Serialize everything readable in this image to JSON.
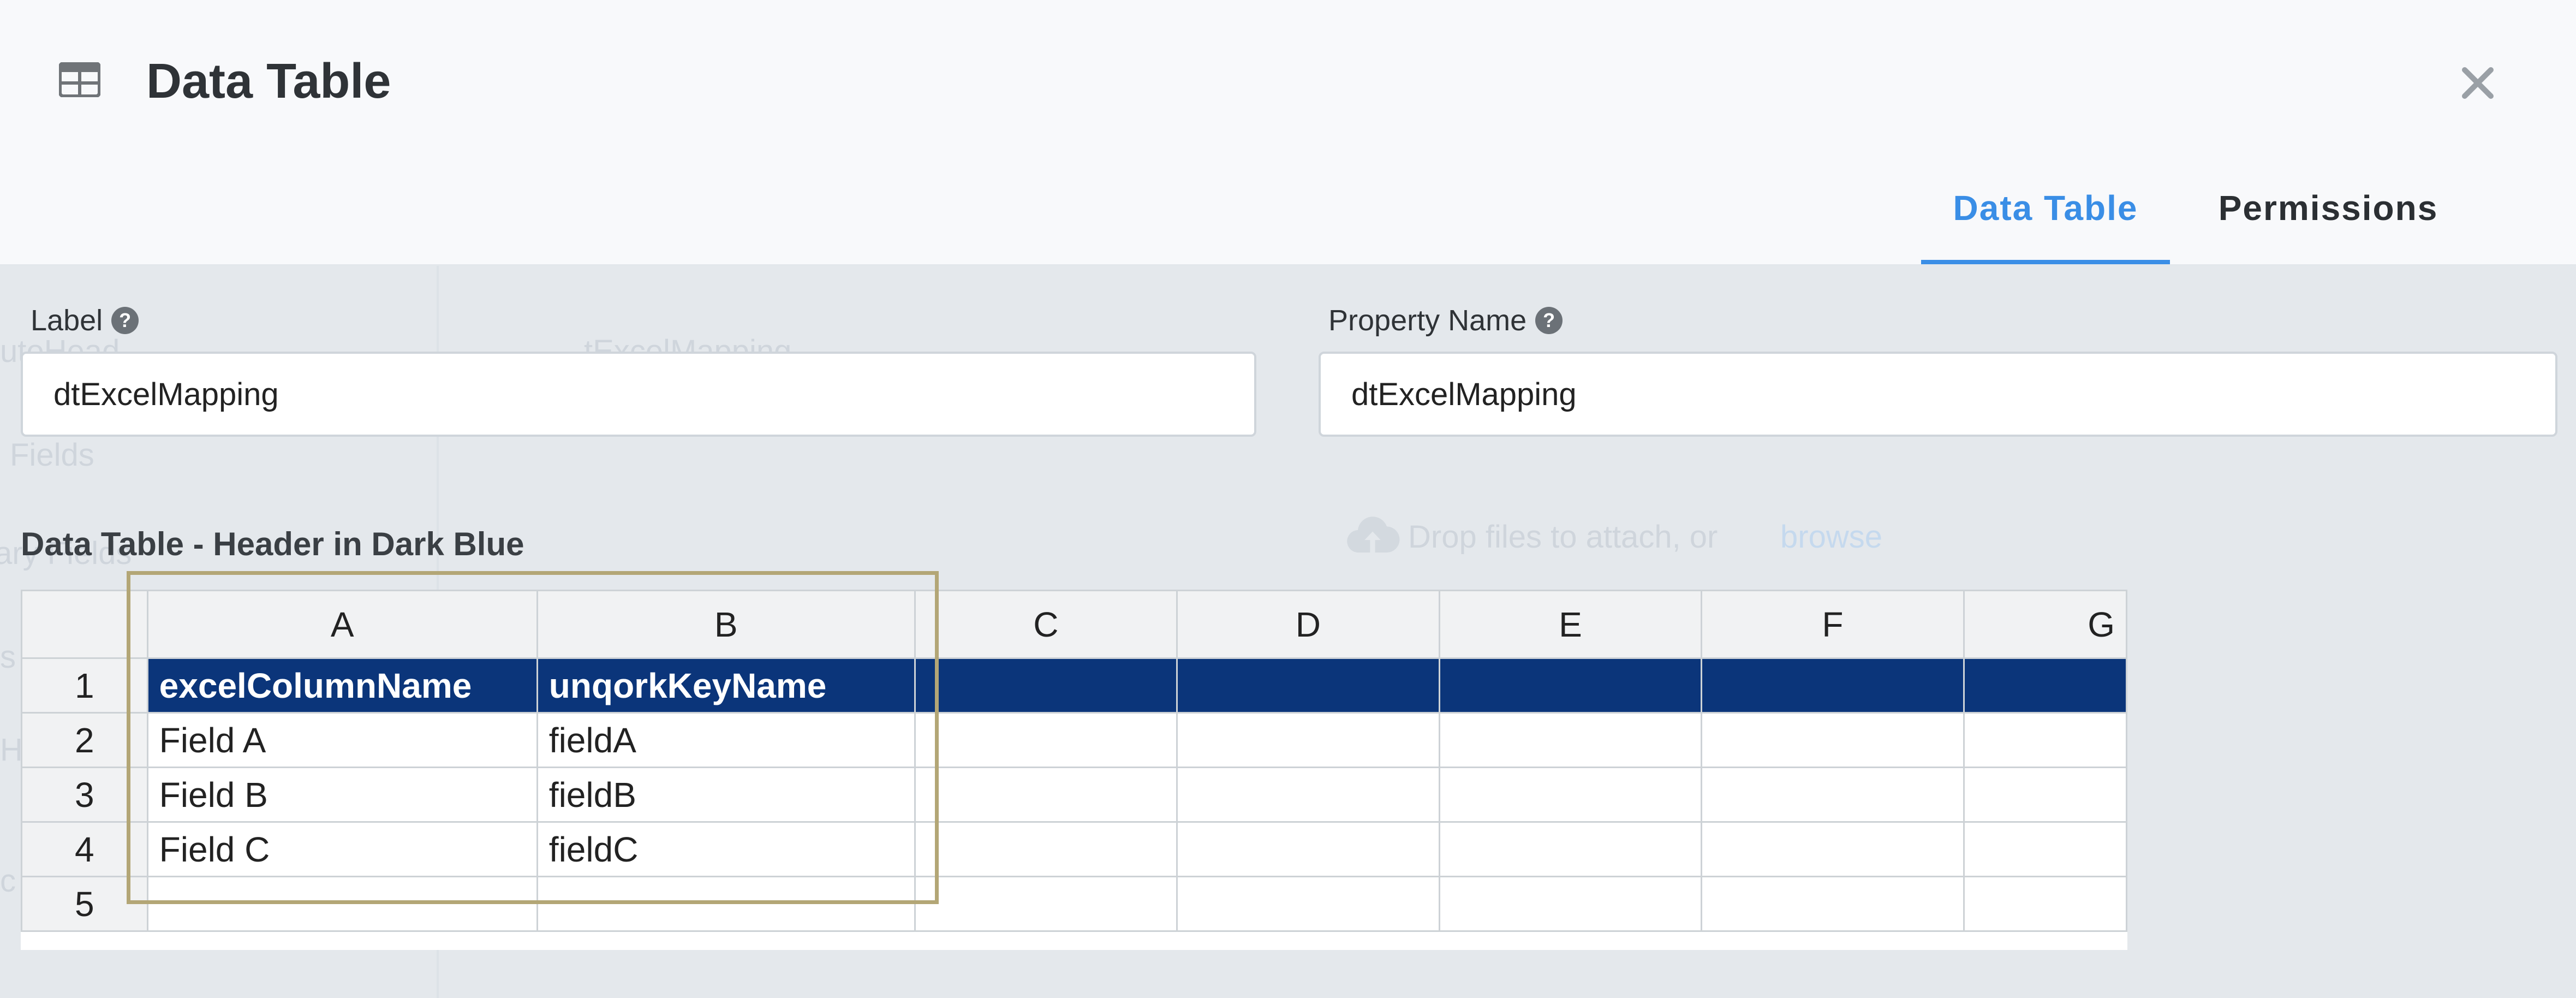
{
  "header": {
    "title": "Data Table",
    "icon": "table-icon",
    "close_icon": "close-icon"
  },
  "tabs": [
    {
      "label": "Data Table",
      "active": true
    },
    {
      "label": "Permissions",
      "active": false
    }
  ],
  "form": {
    "label": {
      "caption": "Label",
      "value": "dtExcelMapping"
    },
    "property_name": {
      "caption": "Property Name",
      "value": "dtExcelMapping"
    },
    "help_glyph": "?"
  },
  "section": {
    "heading": "Data Table - Header in Dark Blue"
  },
  "sheet": {
    "columns": [
      "A",
      "B",
      "C",
      "D",
      "E",
      "F",
      "G"
    ],
    "rows": [
      {
        "num": "1",
        "cells": [
          "excelColumnName",
          "unqorkKeyName",
          "",
          "",
          "",
          "",
          ""
        ]
      },
      {
        "num": "2",
        "cells": [
          "Field A",
          "fieldA",
          "",
          "",
          "",
          "",
          ""
        ]
      },
      {
        "num": "3",
        "cells": [
          "Field B",
          "fieldB",
          "",
          "",
          "",
          "",
          ""
        ]
      },
      {
        "num": "4",
        "cells": [
          "Field C",
          "fieldC",
          "",
          "",
          "",
          "",
          ""
        ]
      },
      {
        "num": "5",
        "cells": [
          "",
          "",
          "",
          "",
          "",
          "",
          ""
        ]
      }
    ]
  },
  "background": {
    "ghost_1": "utoHead",
    "ghost_2": "Fields",
    "ghost_3": "ary Fields",
    "ghost_4": "s &",
    "ghost_5": "H",
    "ghost_6": "c",
    "ghost_7": "tExcelMapping",
    "dropzone_text": "Drop files to attach, or",
    "dropzone_link": "browse"
  },
  "colors": {
    "accent": "#3a8ee6",
    "sheet_header_row": "#0b357a",
    "highlight_border": "#b3a676"
  }
}
